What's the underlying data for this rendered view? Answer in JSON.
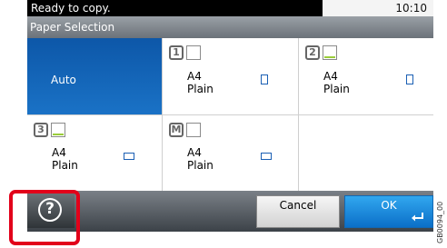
{
  "status": {
    "message": "Ready to copy.",
    "time": "10:10"
  },
  "title": "Paper Selection",
  "options": [
    {
      "id": "auto",
      "label": "Auto",
      "selected": true
    },
    {
      "id": "tray1",
      "tray_icon": "tray-1-icon",
      "tray_number": "1",
      "size": "A4",
      "type": "Plain",
      "orientation": "portrait",
      "paper_loaded": false
    },
    {
      "id": "tray2",
      "tray_icon": "tray-2-icon",
      "tray_number": "2",
      "size": "A4",
      "type": "Plain",
      "orientation": "portrait",
      "paper_loaded": true
    },
    {
      "id": "tray3",
      "tray_icon": "tray-3-icon",
      "tray_number": "3",
      "size": "A4",
      "type": "Plain",
      "orientation": "landscape",
      "paper_loaded": true
    },
    {
      "id": "mp-tray",
      "tray_icon": "mp-tray-icon",
      "tray_number": "M",
      "size": "A4",
      "type": "Plain",
      "orientation": "landscape",
      "paper_loaded": false
    }
  ],
  "buttons": {
    "help_icon": "help-icon",
    "cancel": "Cancel",
    "ok": "OK",
    "ok_icon": "enter-icon"
  },
  "side_code": "GB0094_00",
  "colors": {
    "selected": "#1565c0",
    "highlight": "#e2001a",
    "ok_button": "#1e88e5",
    "paper_loaded": "#9acd3a"
  }
}
